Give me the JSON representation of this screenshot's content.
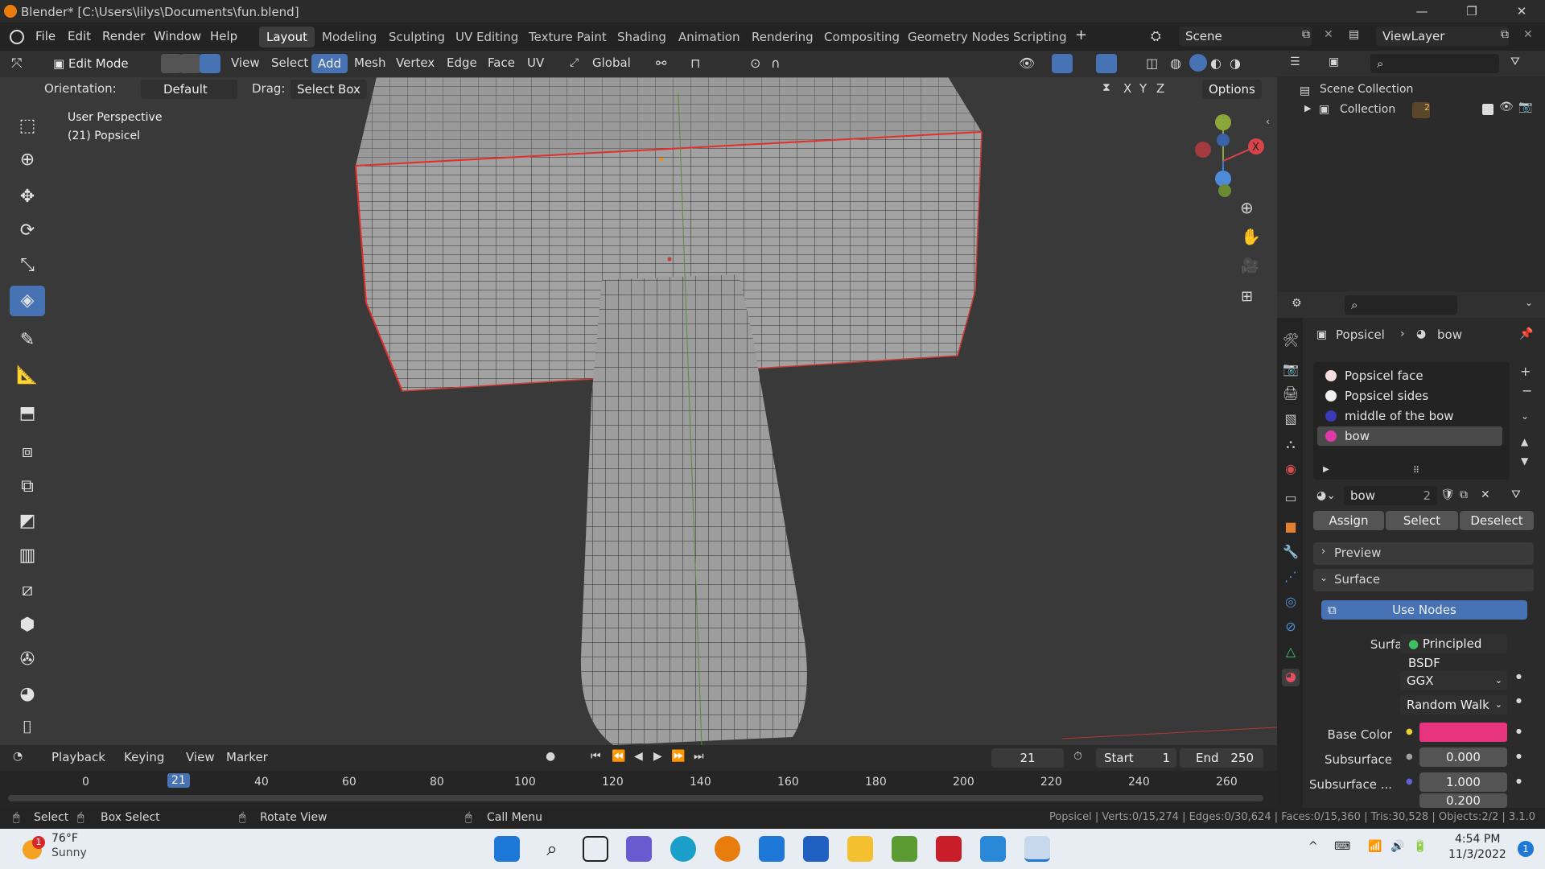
{
  "window": {
    "title": "Blender* [C:\\Users\\lilys\\Documents\\fun.blend]"
  },
  "menu": [
    "File",
    "Edit",
    "Render",
    "Window",
    "Help"
  ],
  "workspaces": [
    "Layout",
    "Modeling",
    "Sculpting",
    "UV Editing",
    "Texture Paint",
    "Shading",
    "Animation",
    "Rendering",
    "Compositing",
    "Geometry Nodes",
    "Scripting"
  ],
  "active_workspace": "Layout",
  "scene": "Scene",
  "view_layer": "ViewLayer",
  "viewport_header": {
    "mode": "Edit Mode",
    "menus": [
      "View",
      "Select",
      "Add",
      "Mesh",
      "Vertex",
      "Edge",
      "Face",
      "UV"
    ],
    "active_menu": "Add",
    "transform_orientation": "Global"
  },
  "tool_settings": {
    "orientation_label": "Orientation:",
    "orientation_value": "Default",
    "drag_label": "Drag:",
    "drag_value": "Select Box",
    "axes": [
      "X",
      "Y",
      "Z"
    ],
    "options_label": "Options"
  },
  "viewport": {
    "view_name": "User Perspective",
    "object_info": "(21) Popsicel"
  },
  "outliner": {
    "root": "Scene Collection",
    "collection": "Collection",
    "badge": "2"
  },
  "properties": {
    "breadcrumb_object": "Popsicel",
    "breadcrumb_material": "bow",
    "material_slots": [
      {
        "name": "Popsicel face",
        "color": "#f4dede"
      },
      {
        "name": "Popsicel sides",
        "color": "#f0f0f0"
      },
      {
        "name": "middle of the bow",
        "color": "#3a3ab8"
      },
      {
        "name": "bow",
        "color": "#e03aa8"
      }
    ],
    "active_slot": "bow",
    "material_name": "bow",
    "material_users": "2",
    "buttons": [
      "Assign",
      "Select",
      "Deselect"
    ],
    "panels": {
      "preview": "Preview",
      "surface": "Surface"
    },
    "use_nodes": "Use Nodes",
    "surface_label": "Surface",
    "surface_value": "Principled BSDF",
    "distribution": "GGX",
    "subsurface_method": "Random Walk",
    "base_color_label": "Base Color",
    "base_color": "#e8347f",
    "subsurface_label": "Subsurface",
    "subsurface_value": "0.000",
    "subsurface_radius_label": "Subsurface ...",
    "subsurface_radius_value": "1.000",
    "subsurface_radius_next": "0.200"
  },
  "timeline": {
    "menus": [
      "Playback",
      "Keying",
      "View",
      "Marker"
    ],
    "current_frame": "21",
    "start_label": "Start",
    "start": "1",
    "end_label": "End",
    "end": "250",
    "ruler": [
      "0",
      "21",
      "40",
      "60",
      "80",
      "100",
      "120",
      "140",
      "160",
      "180",
      "200",
      "220",
      "240",
      "260"
    ]
  },
  "statusbar": {
    "left": [
      "Select",
      "Box Select",
      "Rotate View",
      "Call Menu"
    ],
    "stats": "Popsicel | Verts:0/15,274 | Edges:0/30,624 | Faces:0/15,360 | Tris:30,528 | Objects:2/2 | 3.1.0"
  },
  "taskbar": {
    "weather_temp": "76°F",
    "weather_desc": "Sunny",
    "weather_badge": "1",
    "time": "4:54 PM",
    "date": "11/3/2022",
    "notification_count": "1"
  },
  "colors": {
    "accent": "#4772b3",
    "selected_edge": "#e0302c"
  }
}
